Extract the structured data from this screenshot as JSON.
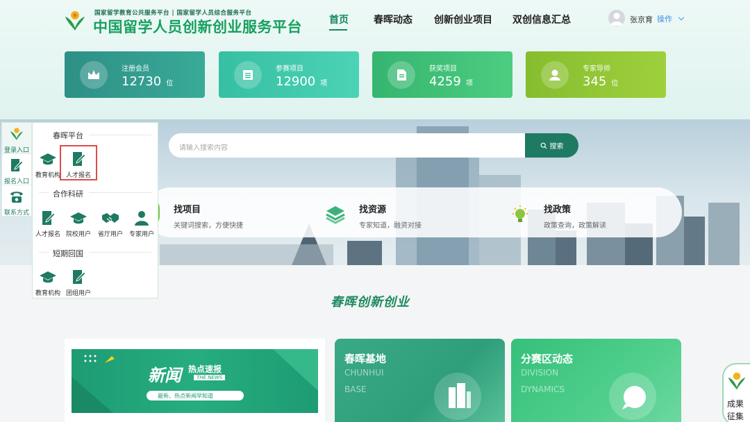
{
  "header": {
    "sub_title": "国家留学教育公共服务平台 | 国家留学人员综合服务平台",
    "title": "中国留学人员创新创业服务平台",
    "nav": [
      "首页",
      "春晖动态",
      "创新创业项目",
      "双创信息汇总"
    ],
    "user": "张京育",
    "operate": "操作"
  },
  "stats": [
    {
      "label": "注册会员",
      "value": "12730",
      "unit": "位",
      "icon": "crown-icon",
      "color": "#2e9f8f"
    },
    {
      "label": "参赛项目",
      "value": "12900",
      "unit": "项",
      "icon": "list-icon",
      "color": "#3bc6a4"
    },
    {
      "label": "获奖项目",
      "value": "4259",
      "unit": "项",
      "icon": "document-icon",
      "color": "#3cc27a"
    },
    {
      "label": "专家导师",
      "value": "345",
      "unit": "位",
      "icon": "user-icon",
      "color": "#8fc534"
    }
  ],
  "search": {
    "placeholder": "请输入搜索内容",
    "button": "搜索"
  },
  "find": [
    {
      "title": "找项目",
      "desc": "关键词搜索，方便快捷"
    },
    {
      "title": "找资源",
      "desc": "专家知道，融资对接"
    },
    {
      "title": "找政策",
      "desc": "政策查询，政策解读"
    }
  ],
  "rail": [
    "登录入口",
    "报名入口",
    "联系方式"
  ],
  "panel": {
    "sections": [
      {
        "title": "春晖平台",
        "items": [
          "教育机构",
          "人才报名"
        ]
      },
      {
        "title": "合作科研",
        "items": [
          "人才报名",
          "院校用户",
          "省厅用户",
          "专家用户"
        ]
      },
      {
        "title": "短期回国",
        "items": [
          "教育机构",
          "团组用户"
        ]
      }
    ]
  },
  "section_title": "春晖创新创业",
  "news": {
    "title": "新闻",
    "hot": "热点速报",
    "en": "THE NEWS",
    "slogan": "最新、热点新闻早知道"
  },
  "base": {
    "title": "春晖基地",
    "en1": "CHUNHUI",
    "en2": "BASE"
  },
  "division": {
    "title": "分赛区动态",
    "en1": "DIVISION",
    "en2": "DYNAMICS"
  },
  "result": {
    "line1": "成果",
    "line2": "征集"
  }
}
